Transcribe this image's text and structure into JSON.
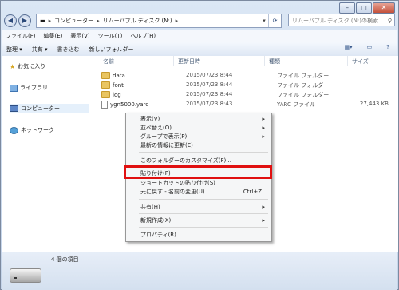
{
  "window": {
    "controls": {
      "minimize": "–",
      "maximize": "□",
      "close": "✕"
    }
  },
  "nav": {
    "back_glyph": "◀",
    "forward_glyph": "▶",
    "breadcrumb": [
      "コンピューター",
      "リムーバブル ディスク (N:)"
    ],
    "breadcrumb_sep": "▸",
    "refresh_glyph": "⟳",
    "search_placeholder": "リムーバブル ディスク (N:)の検索"
  },
  "menubar": [
    "ファイル(F)",
    "編集(E)",
    "表示(V)",
    "ツール(T)",
    "ヘルプ(H)"
  ],
  "toolbar": {
    "items": [
      "整理 ▾",
      "共有 ▾",
      "書き込む",
      "新しいフォルダー"
    ],
    "right_icons": [
      "views-icon",
      "preview-pane-icon",
      "help-icon"
    ]
  },
  "sidebar": {
    "items": [
      {
        "label": "お気に入り",
        "icon": "star-icon"
      },
      {
        "label": "ライブラリ",
        "icon": "library-icon"
      },
      {
        "label": "コンピューター",
        "icon": "computer-icon"
      },
      {
        "label": "ネットワーク",
        "icon": "network-icon"
      }
    ]
  },
  "columns": {
    "name": "名前",
    "date": "更新日時",
    "type": "種類",
    "size": "サイズ"
  },
  "files": [
    {
      "name": "data",
      "date": "2015/07/23 8:44",
      "type": "ファイル フォルダー",
      "size": "",
      "icon": "folder-icon"
    },
    {
      "name": "font",
      "date": "2015/07/23 8:44",
      "type": "ファイル フォルダー",
      "size": "",
      "icon": "folder-icon"
    },
    {
      "name": "log",
      "date": "2015/07/23 8:44",
      "type": "ファイル フォルダー",
      "size": "",
      "icon": "folder-icon"
    },
    {
      "name": "ygn5000.yarc",
      "date": "2015/07/23 8:43",
      "type": "YARC ファイル",
      "size": "27,443 KB",
      "icon": "file-icon"
    }
  ],
  "context_menu": {
    "items": [
      {
        "label": "表示(V)",
        "arrow": "▸"
      },
      {
        "label": "並べ替え(O)",
        "arrow": "▸"
      },
      {
        "label": "グループで表示(P)",
        "arrow": "▸"
      },
      {
        "label": "最新の情報に更新(E)",
        "arrow": ""
      },
      {
        "label": "このフォルダーのカスタマイズ(F)...",
        "arrow": ""
      },
      {
        "label": "貼り付け(P)",
        "arrow": ""
      },
      {
        "label": "ショートカットの貼り付け(S)",
        "arrow": ""
      },
      {
        "label": "元に戻す - 名前の変更(U)",
        "shortcut": "Ctrl+Z"
      },
      {
        "label": "共有(H)",
        "arrow": "▸"
      },
      {
        "label": "新規作成(X)",
        "arrow": "▸"
      },
      {
        "label": "プロパティ(R)",
        "arrow": ""
      }
    ],
    "highlight_color": "#e01010"
  },
  "status": {
    "count": "4 個の項目"
  }
}
